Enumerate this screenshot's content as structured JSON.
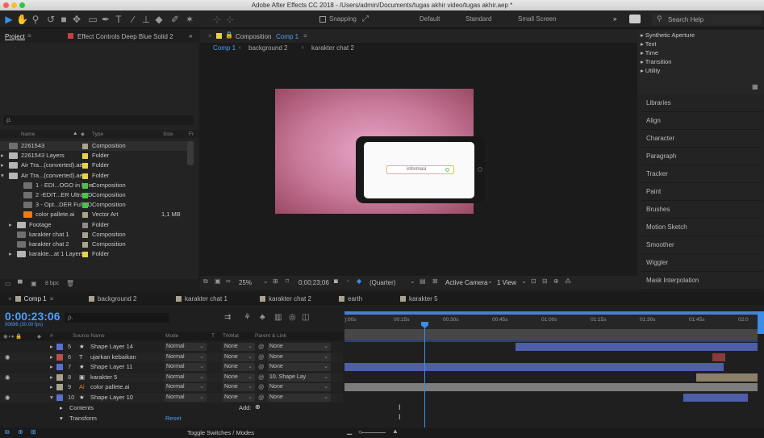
{
  "window": {
    "title": "Adobe After Effects CC 2018 - /Users/admin/Documents/tugas akhir video/tugas akhir.aep *"
  },
  "toolbar": {
    "snapping_label": "Snapping",
    "workspaces": [
      "Default",
      "Standard",
      "Small Screen"
    ],
    "more_label": "»",
    "search_placeholder": "Search Help"
  },
  "project_panel": {
    "tab_project": "Project",
    "tab_effect_controls": "Effect Controls Deep Blue Solid 2",
    "columns": {
      "name": "Name",
      "type": "Type",
      "size": "Size",
      "fr": "Fr"
    },
    "bpc_label": "8 bpc",
    "rows": [
      {
        "name": "2261543",
        "type": "Composition",
        "size": "",
        "color": "#a9a38e",
        "selected": false
      },
      {
        "name": "2261543 Layers",
        "type": "Folder",
        "size": "",
        "color": "#e8d24a",
        "selected": false
      },
      {
        "name": "Air Tra...(converted).aep",
        "type": "Folder",
        "size": "",
        "color": "#e8d24a",
        "selected": false
      },
      {
        "name": "Air Tra...(converted).aep",
        "type": "Folder",
        "size": "",
        "color": "#e8d24a",
        "selected": false
      },
      {
        "name": "1 - EDI...OGO in here",
        "type": "Composition",
        "size": "",
        "color": "#4ec04e",
        "selected": false
      },
      {
        "name": "2 -EDIT...ER UltraHD",
        "type": "Composition",
        "size": "",
        "color": "#4ec04e",
        "selected": false
      },
      {
        "name": "3 - Opt...DER FullHD",
        "type": "Composition",
        "size": "",
        "color": "#4ec04e",
        "selected": false
      },
      {
        "name": "color pallete.ai",
        "type": "Vector Art",
        "size": "1,1 MB",
        "color": "#a9a38e",
        "selected": false
      },
      {
        "name": "Footage",
        "type": "Folder",
        "size": "",
        "color": "#8c8c8c",
        "selected": false
      },
      {
        "name": "karakter chat 1",
        "type": "Composition",
        "size": "",
        "color": "#a9a38e",
        "selected": false
      },
      {
        "name": "karakter chat 2",
        "type": "Composition",
        "size": "",
        "color": "#a9a38e",
        "selected": false
      },
      {
        "name": "karakte...at 1 Layers",
        "type": "Folder",
        "size": "",
        "color": "#e8d24a",
        "selected": false
      }
    ]
  },
  "composition_panel": {
    "tab_label": "Composition",
    "comp_name": "Comp 1",
    "breadcrumbs": [
      "Comp 1",
      "background 2",
      "karakter chat 2"
    ],
    "phone_text": "informasi",
    "zoom": "25%",
    "timecode": "0;00;23;06",
    "resolution": "(Quarter)",
    "camera": "Active Camera",
    "views": "1 View"
  },
  "right_panel": {
    "sections": [
      "Synthetic Aperture",
      "Text",
      "Time",
      "Transition",
      "Utility"
    ],
    "items": [
      "Libraries",
      "Align",
      "Character",
      "Paragraph",
      "Tracker",
      "Paint",
      "Brushes",
      "Motion Sketch",
      "Smoother",
      "Wiggler",
      "Mask Interpolation"
    ]
  },
  "timeline": {
    "tabs": [
      {
        "label": "Comp 1",
        "color": "#a9a38e"
      },
      {
        "label": "background 2",
        "color": "#a9a38e"
      },
      {
        "label": "karakter chat 1",
        "color": "#a9a38e"
      },
      {
        "label": "karakter chat 2",
        "color": "#a9a38e"
      },
      {
        "label": "earth",
        "color": "#a9a38e"
      },
      {
        "label": "karakter 5",
        "color": "#a9a38e"
      }
    ],
    "timecode": "0:00:23:06",
    "frame_info": "00696 (30.00 fps)",
    "search_placeholder": "ρ.",
    "column_headers": {
      "num": "#",
      "source_name": "Source Name",
      "mode": "Mode",
      "t": "T",
      "trkmat": "TrkMat",
      "parent": "Parent & Link"
    },
    "ruler_labels": [
      "):00s",
      "00:15s",
      "00:30s",
      "00:45s",
      "01:00s",
      "01:15s",
      "01:30s",
      "01:45s",
      "02:0"
    ],
    "layers": [
      {
        "num": "5",
        "name": "Shape Layer 14",
        "icon": "star",
        "color": "#5a6fd1",
        "mode": "Normal",
        "trkmat": "None",
        "parent": "None",
        "eye": false,
        "expanded": false
      },
      {
        "num": "6",
        "name": "ujarkan kebaikan",
        "icon": "text",
        "color": "#c14a4a",
        "mode": "Normal",
        "trkmat": "None",
        "parent": "None",
        "eye": true,
        "expanded": false
      },
      {
        "num": "7",
        "name": "Shape Layer 11",
        "icon": "star",
        "color": "#5a6fd1",
        "mode": "Normal",
        "trkmat": "None",
        "parent": "None",
        "eye": false,
        "expanded": false
      },
      {
        "num": "8",
        "name": "karakter 5",
        "icon": "comp",
        "color": "#a9a38e",
        "mode": "Normal",
        "trkmat": "None",
        "parent": "10. Shape Lay",
        "eye": true,
        "expanded": false
      },
      {
        "num": "9",
        "name": "color pallete.ai",
        "icon": "ai",
        "color": "#a9a38e",
        "mode": "Normal",
        "trkmat": "None",
        "parent": "None",
        "eye": false,
        "expanded": false
      },
      {
        "num": "10",
        "name": "Shape Layer 10",
        "icon": "star",
        "color": "#5a6fd1",
        "mode": "Normal",
        "trkmat": "None",
        "parent": "None",
        "eye": true,
        "expanded": true
      }
    ],
    "sub_rows": {
      "contents": "Contents",
      "add_label": "Add:",
      "transform": "Transform",
      "reset_label": "Reset"
    },
    "toggle_label": "Toggle Switches / Modes"
  }
}
